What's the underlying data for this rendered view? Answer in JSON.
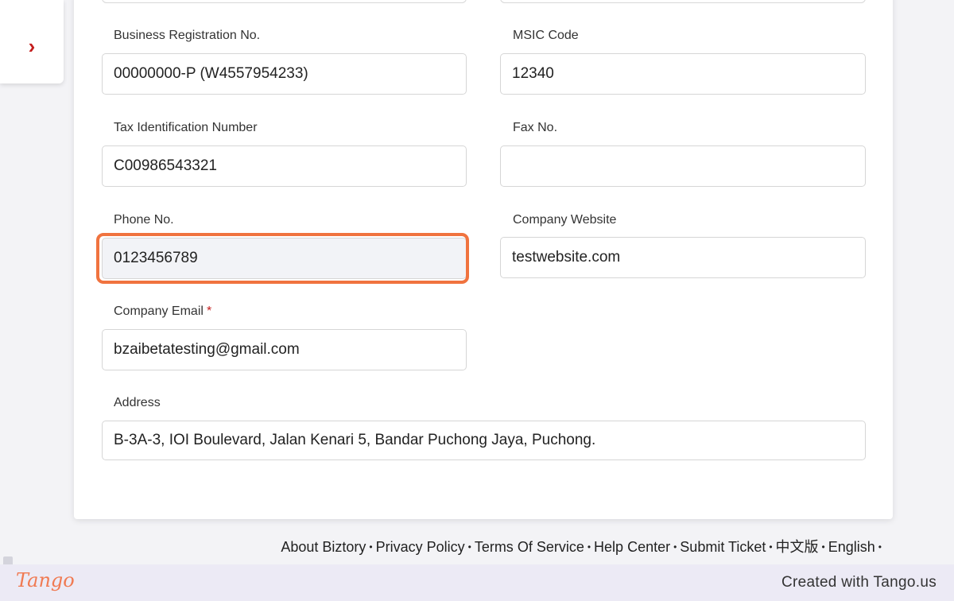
{
  "sidebar": {
    "toggle_icon": "chevron-right-icon",
    "toggle_glyph": "›"
  },
  "form": {
    "business_registration": {
      "label": "Business Registration No.",
      "value": "00000000-P (W4557954233)"
    },
    "msic_code": {
      "label": "MSIC Code",
      "value": "12340"
    },
    "tax_id": {
      "label": "Tax Identification Number",
      "value": "C00986543321"
    },
    "fax": {
      "label": "Fax No.",
      "value": ""
    },
    "phone": {
      "label": "Phone No.",
      "value": "0123456789"
    },
    "website": {
      "label": "Company Website",
      "value": "testwebsite.com"
    },
    "email": {
      "label": "Company Email",
      "required_mark": "*",
      "value": "bzaibetatesting@gmail.com"
    },
    "address": {
      "label": "Address",
      "value": "B-3A-3, IOI Boulevard, Jalan Kenari 5, Bandar Puchong Jaya, Puchong."
    }
  },
  "footer": {
    "links": [
      "About Biztory",
      "Privacy Policy",
      "Terms Of Service",
      "Help Center",
      "Submit Ticket",
      "中文版",
      "English"
    ],
    "separator": "•"
  },
  "tango": {
    "logo": "Tango",
    "credit": "Created with Tango.us"
  },
  "colors": {
    "accent": "#c41e1e",
    "highlight": "#f0733f",
    "tango_bar": "#eceaf5"
  }
}
